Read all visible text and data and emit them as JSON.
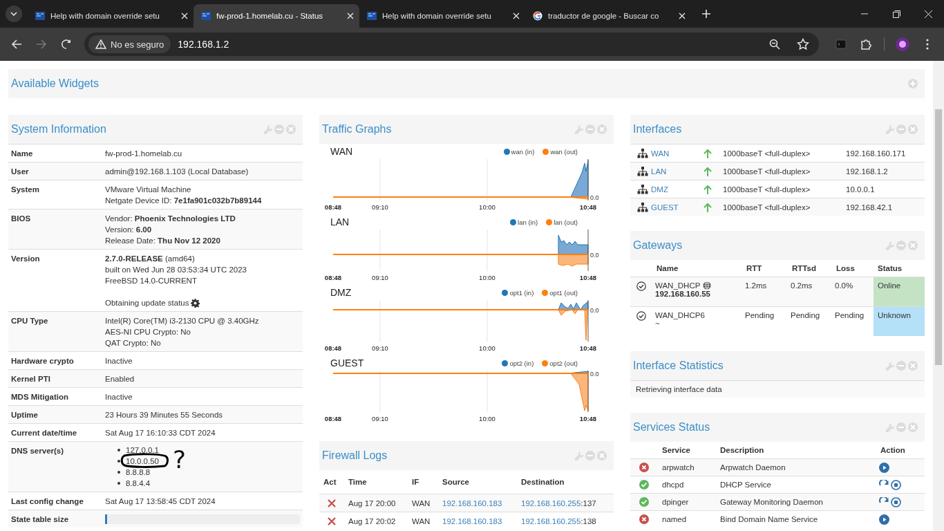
{
  "browser": {
    "tabs": [
      {
        "title": "Help with domain override setu",
        "selected": false,
        "kind": "firewall"
      },
      {
        "title": "fw-prod-1.homelab.cu - Status",
        "selected": true,
        "kind": "firewall"
      },
      {
        "title": "Help with domain override setu",
        "selected": false,
        "kind": "firewall"
      },
      {
        "title": "traductor de google - Buscar co",
        "selected": false,
        "kind": "search"
      }
    ],
    "security_label": "No es seguro",
    "url": "192.168.1.2"
  },
  "available_widgets": {
    "title": "Available Widgets"
  },
  "system_information": {
    "title": "System Information",
    "rows": [
      {
        "label": "Name",
        "lines": [
          "fw-prod-1.homelab.cu"
        ]
      },
      {
        "label": "User",
        "lines": [
          "admin@192.168.1.103 (Local Database)"
        ]
      },
      {
        "label": "System",
        "lines": [
          "VMware Virtual Machine",
          "Netgate Device ID: **7e1fa901c032b7b89144**"
        ]
      },
      {
        "label": "BIOS",
        "lines": [
          "Vendor: **Phoenix Technologies LTD**",
          "Version: **6.00**",
          "Release Date: **Thu Nov 12 2020**"
        ]
      },
      {
        "label": "Version",
        "lines": [
          "**2.7.0-RELEASE** (amd64)",
          "built on Wed Jun 28 03:53:34 UTC 2023",
          "FreeBSD 14.0-CURRENT"
        ],
        "update_status": "Obtaining update status"
      },
      {
        "label": "CPU Type",
        "lines": [
          "Intel(R) Core(TM) i3-2130 CPU @ 3.40GHz",
          "AES-NI CPU Crypto: No",
          "QAT Crypto: No"
        ]
      },
      {
        "label": "Hardware crypto",
        "lines": [
          "Inactive"
        ]
      },
      {
        "label": "Kernel PTI",
        "lines": [
          "Enabled"
        ]
      },
      {
        "label": "MDS Mitigation",
        "lines": [
          "Inactive"
        ]
      },
      {
        "label": "Uptime",
        "lines": [
          "23 Hours 39 Minutes 55 Seconds"
        ]
      },
      {
        "label": "Current date/time",
        "lines": [
          "Sat Aug 17 16:10:33 CDT 2024"
        ]
      },
      {
        "label": "DNS server(s)",
        "list": [
          {
            "text": "127.0.0.1",
            "circled": false
          },
          {
            "text": "10.0.0.50",
            "circled": true
          },
          {
            "text": "8.8.8.8",
            "circled": false
          },
          {
            "text": "8.8.4.4",
            "circled": false
          }
        ],
        "annotation": "?"
      },
      {
        "label": "Last config change",
        "lines": [
          "Sat Aug 17 13:58:45 CDT 2024"
        ]
      },
      {
        "label": "State table size",
        "level": 0.01
      }
    ]
  },
  "traffic_graphs": {
    "title": "Traffic Graphs",
    "graphs": [
      {
        "name": "WAN",
        "legend": [
          "wan (in)",
          "wan (out)"
        ],
        "y_tick": "0.0",
        "x_ticks": [
          "08:48",
          "09:10",
          "10:00",
          "10:48"
        ]
      },
      {
        "name": "LAN",
        "legend": [
          "lan (in)",
          "lan (out)"
        ],
        "y_tick": "0.0",
        "x_ticks": [
          "08:48",
          "09:10",
          "10:00",
          "10:48"
        ]
      },
      {
        "name": "DMZ",
        "legend": [
          "opt1 (in)",
          "opt1 (out)"
        ],
        "y_tick": "0.0",
        "x_ticks": [
          "08:48",
          "09:10",
          "10:00",
          "10:48"
        ]
      },
      {
        "name": "GUEST",
        "legend": [
          "opt2 (in)",
          "opt2 (out)"
        ],
        "y_tick": "0.0",
        "x_ticks": [
          "08:48",
          "09:10",
          "10:00",
          "10:48"
        ]
      }
    ]
  },
  "firewall_logs": {
    "title": "Firewall Logs",
    "columns": [
      "Act",
      "Time",
      "IF",
      "Source",
      "Destination"
    ],
    "rows": [
      {
        "kind": "block",
        "time": "Aug 17 20:00",
        "interface": "WAN",
        "source": "192.168.160.183",
        "destination": "192.168.160.255",
        "port": ":137"
      },
      {
        "kind": "block",
        "time": "Aug 17 20:02",
        "interface": "WAN",
        "source": "192.168.160.183",
        "destination": "192.168.160.255",
        "port": ":138"
      }
    ]
  },
  "interfaces": {
    "title": "Interfaces",
    "rows": [
      {
        "name": "WAN",
        "up": true,
        "media": "1000baseT <full-duplex>",
        "ip": "192.168.160.171"
      },
      {
        "name": "LAN",
        "up": true,
        "media": "1000baseT <full-duplex>",
        "ip": "192.168.1.2"
      },
      {
        "name": "DMZ",
        "up": true,
        "media": "1000baseT <full-duplex>",
        "ip": "10.0.0.1"
      },
      {
        "name": "GUEST",
        "up": true,
        "media": "1000baseT <full-duplex>",
        "ip": "192.168.42.1"
      }
    ]
  },
  "gateways": {
    "title": "Gateways",
    "columns": [
      "Name",
      "RTT",
      "RTTsd",
      "Loss",
      "Status"
    ],
    "rows": [
      {
        "name": "WAN_DHCP",
        "default": true,
        "address": "192.168.160.55",
        "rtt": "1.2ms",
        "rttsd": "0.2ms",
        "loss": "0.0%",
        "status": "Online",
        "kind": "online"
      },
      {
        "name": "WAN_DHCP6",
        "default": false,
        "address": "~",
        "rtt": "Pending",
        "rttsd": "Pending",
        "loss": "Pending",
        "status": "Unknown",
        "kind": "unknown"
      }
    ]
  },
  "interface_statistics": {
    "title": "Interface Statistics",
    "message": "Retrieving interface data"
  },
  "services_status": {
    "title": "Services Status",
    "columns": [
      "Service",
      "Description",
      "Action"
    ],
    "rows": [
      {
        "service": "arpwatch",
        "description": "Arpwatch Daemon",
        "running": false
      },
      {
        "service": "dhcpd",
        "description": "DHCP Service",
        "running": true
      },
      {
        "service": "dpinger",
        "description": "Gateway Monitoring Daemon",
        "running": true
      },
      {
        "service": "named",
        "description": "Bind Domain Name Service",
        "running": false
      }
    ]
  }
}
